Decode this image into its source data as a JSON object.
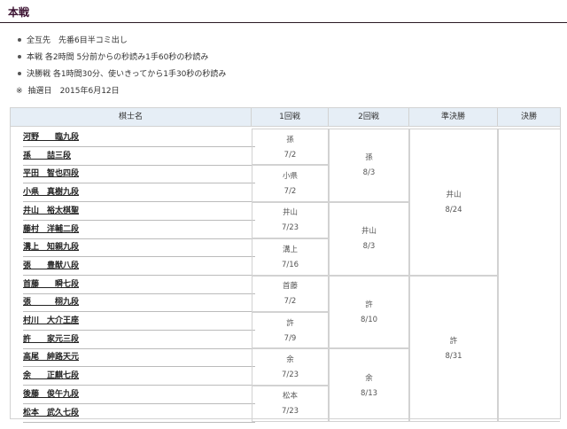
{
  "title": "本戦",
  "notes": [
    "全互先　先番6目半コミ出し",
    "本戦 各2時間 5分前からの秒読み1手60秒の秒読み",
    "決勝戦 各1時間30分、使いきってから1手30秒の秒読み"
  ],
  "lottery": {
    "mark": "※",
    "label": "抽選日",
    "date": "2015年6月12日"
  },
  "bracket": {
    "headers": [
      "棋士名",
      "1回戦",
      "2回戦",
      "準決勝",
      "決勝"
    ],
    "players": [
      "河野　　臨九段",
      "孫　　喆三段",
      "平田　智也四段",
      "小県　真樹九段",
      "井山　裕太棋聖",
      "藤村　洋輔二段",
      "溝上　知親九段",
      "張　　豊猷八段",
      "首藤　　瞬七段",
      "張　　　栩九段",
      "村川　大介王座",
      "許　　家元三段",
      "高尾　紳路天元",
      "余　　正麒七段",
      "後藤　俊午九段",
      "松本　武久七段"
    ],
    "round1": [
      {
        "winner": "孫",
        "date": "7/2"
      },
      {
        "winner": "小県",
        "date": "7/2"
      },
      {
        "winner": "井山",
        "date": "7/23"
      },
      {
        "winner": "溝上",
        "date": "7/16"
      },
      {
        "winner": "首藤",
        "date": "7/2"
      },
      {
        "winner": "許",
        "date": "7/9"
      },
      {
        "winner": "余",
        "date": "7/23"
      },
      {
        "winner": "松本",
        "date": "7/23"
      }
    ],
    "round2": [
      {
        "winner": "孫",
        "date": "8/3"
      },
      {
        "winner": "井山",
        "date": "8/3"
      },
      {
        "winner": "許",
        "date": "8/10"
      },
      {
        "winner": "余",
        "date": "8/13"
      }
    ],
    "semifinal": [
      {
        "winner": "井山",
        "date": "8/24"
      },
      {
        "winner": "許",
        "date": "8/31"
      }
    ]
  }
}
